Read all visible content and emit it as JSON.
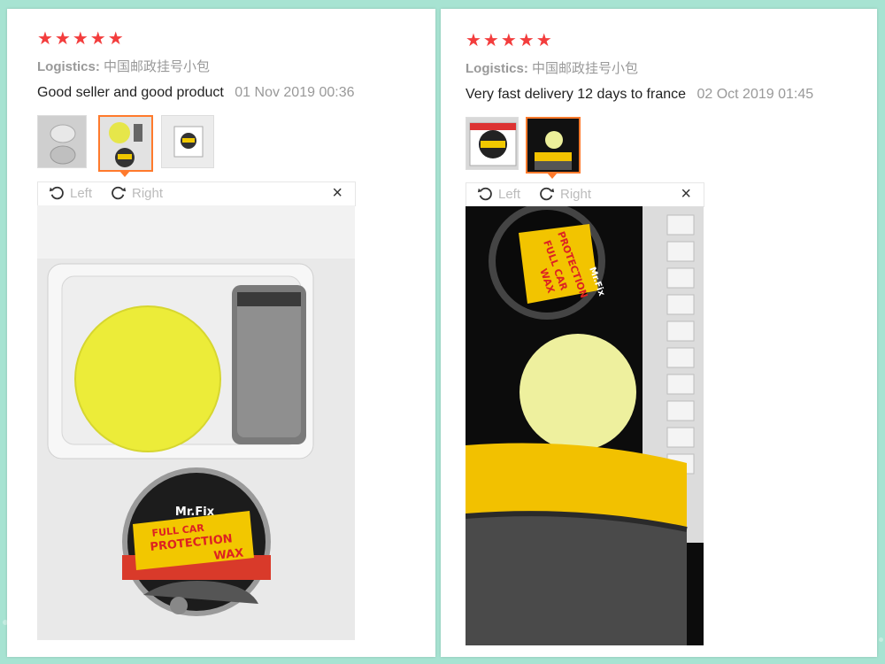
{
  "reviews": [
    {
      "stars": "★★★★★",
      "logistics_label": "Logistics:",
      "logistics_value": "中国邮政挂号小包",
      "comment": "Good seller and good product",
      "date": "01 Nov 2019 00:36",
      "viewer": {
        "left_label": "Left",
        "right_label": "Right",
        "close": "×"
      },
      "thumb_count": 3,
      "active_thumb": 2,
      "photo_text": {
        "brand": "Mr.Fix",
        "line1": "FULL CAR",
        "line2": "PROTECTION",
        "line3": "WAX"
      }
    },
    {
      "stars": "★★★★★",
      "logistics_label": "Logistics:",
      "logistics_value": "中国邮政挂号小包",
      "comment": "Very fast delivery 12 days to france",
      "date": "02 Oct 2019 01:45",
      "viewer": {
        "left_label": "Left",
        "right_label": "Right",
        "close": "×"
      },
      "thumb_count": 2,
      "active_thumb": 2,
      "photo_text": {
        "brand": "Mr.Fix",
        "line1": "FULL CAR",
        "line2": "PROTECTION",
        "line3": "WAX"
      }
    }
  ],
  "colors": {
    "star": "#f33d3d",
    "accent": "#ff7a2c",
    "background": "#a7e3d2"
  },
  "icons": [
    "rotate-left-icon",
    "rotate-right-icon",
    "close-icon",
    "star-icon"
  ]
}
